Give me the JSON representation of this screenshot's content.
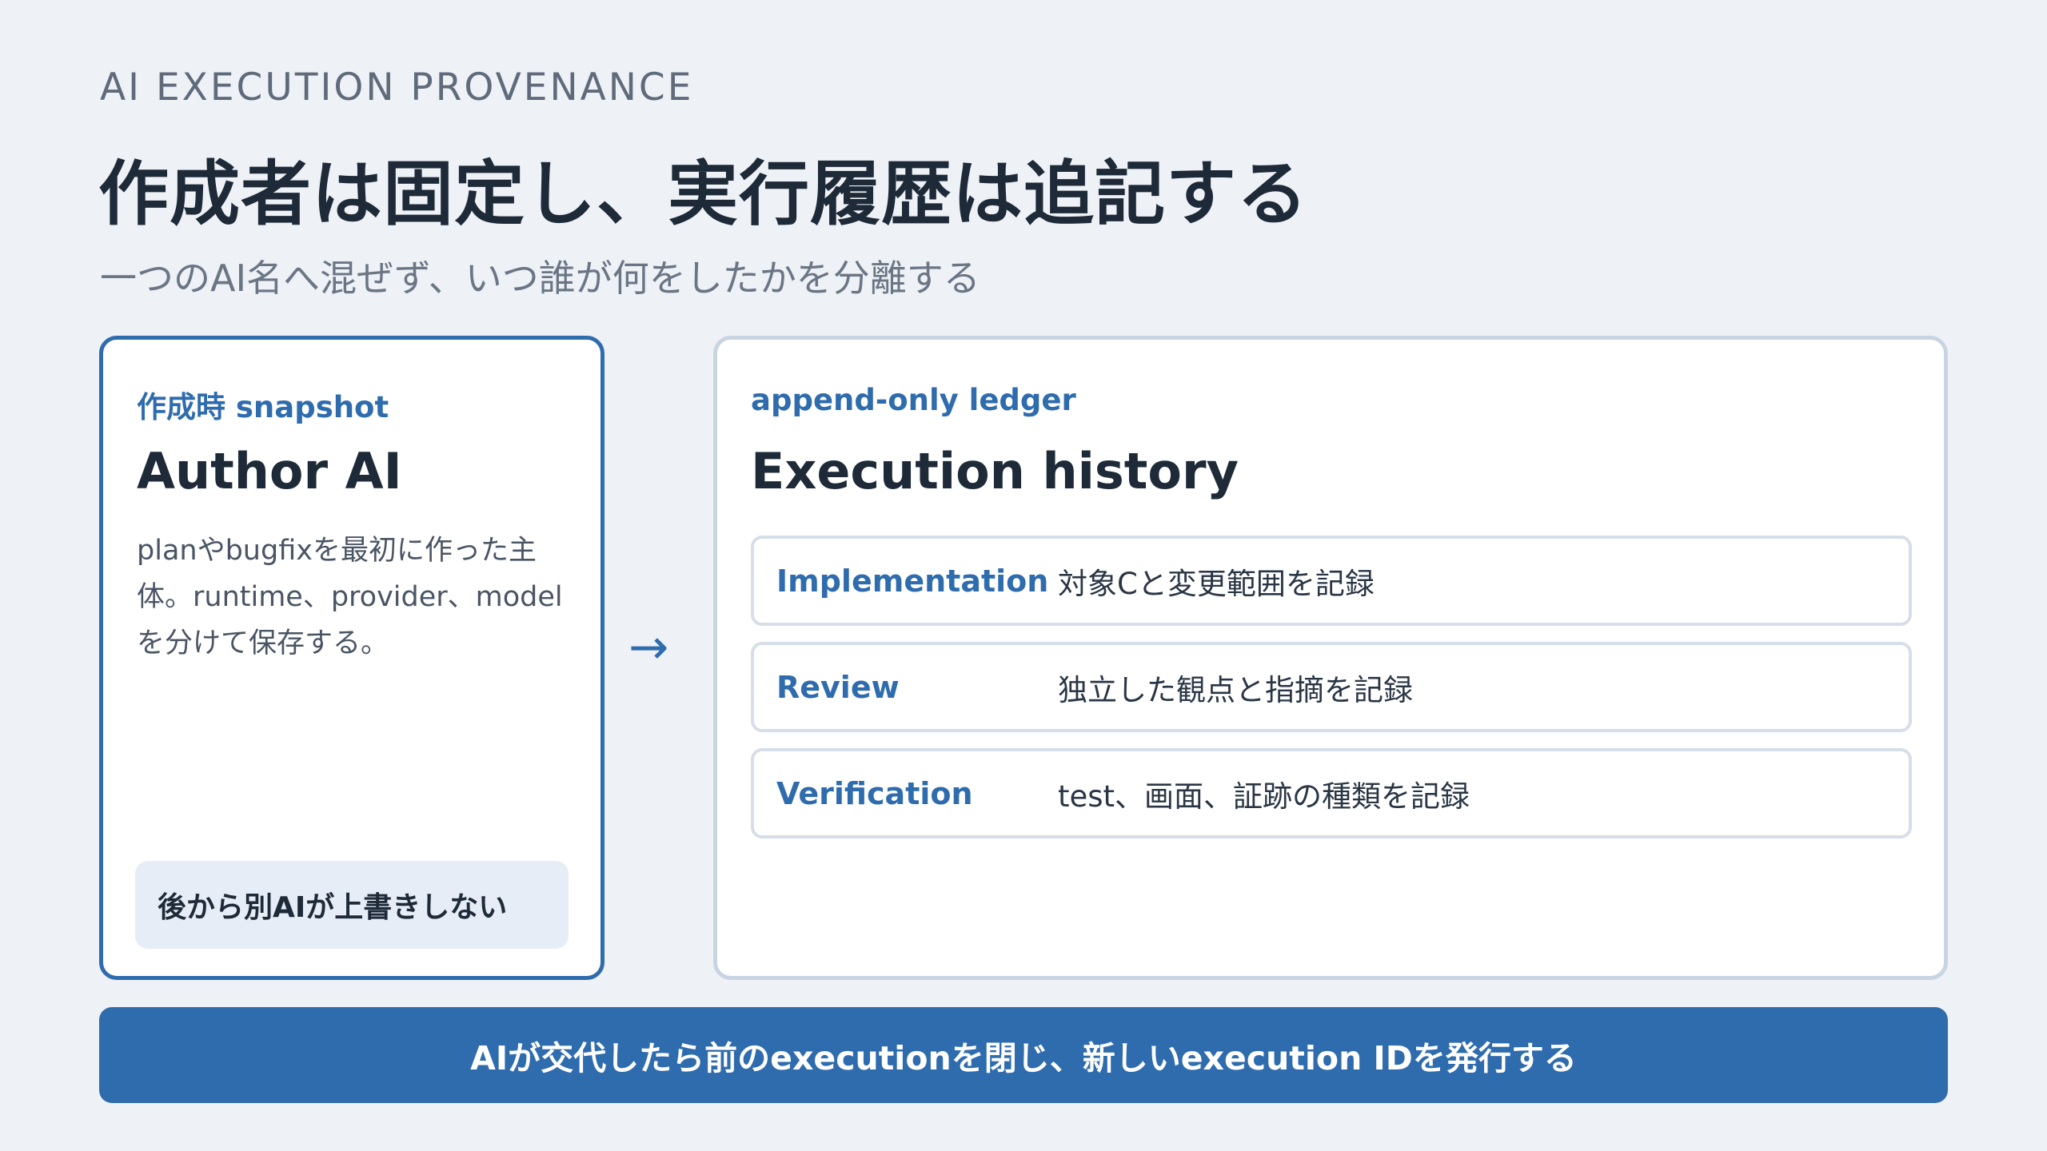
{
  "header": {
    "eyebrow": "AI EXECUTION PROVENANCE",
    "title": "作成者は固定し、実行履歴は追記する",
    "subtitle": "一つのAI名へ混ぜず、いつ誰が何をしたかを分離する"
  },
  "author_card": {
    "label": "作成時 snapshot",
    "heading": "Author AI",
    "body": "planやbugfixを最初に作った主体。runtime、provider、modelを分けて保存する。",
    "note": "後から別AIが上書きしない"
  },
  "arrow": "→",
  "ledger_card": {
    "label": "append-only ledger",
    "heading": "Execution history",
    "rows": [
      {
        "name": "Implementation",
        "desc": "対象Cと変更範囲を記録"
      },
      {
        "name": "Review",
        "desc": "独立した観点と指摘を記録"
      },
      {
        "name": "Verification",
        "desc": "test、画面、証跡の種類を記録"
      }
    ]
  },
  "banner": "AIが交代したら前のexecutionを閉じ、新しいexecution IDを発行する",
  "colors": {
    "background": "#eef1f6",
    "accent": "#2f6cae",
    "text": "#1e2a38",
    "muted": "#6b7685",
    "border": "#c9d4e3",
    "note_bg": "#e6edf7"
  }
}
